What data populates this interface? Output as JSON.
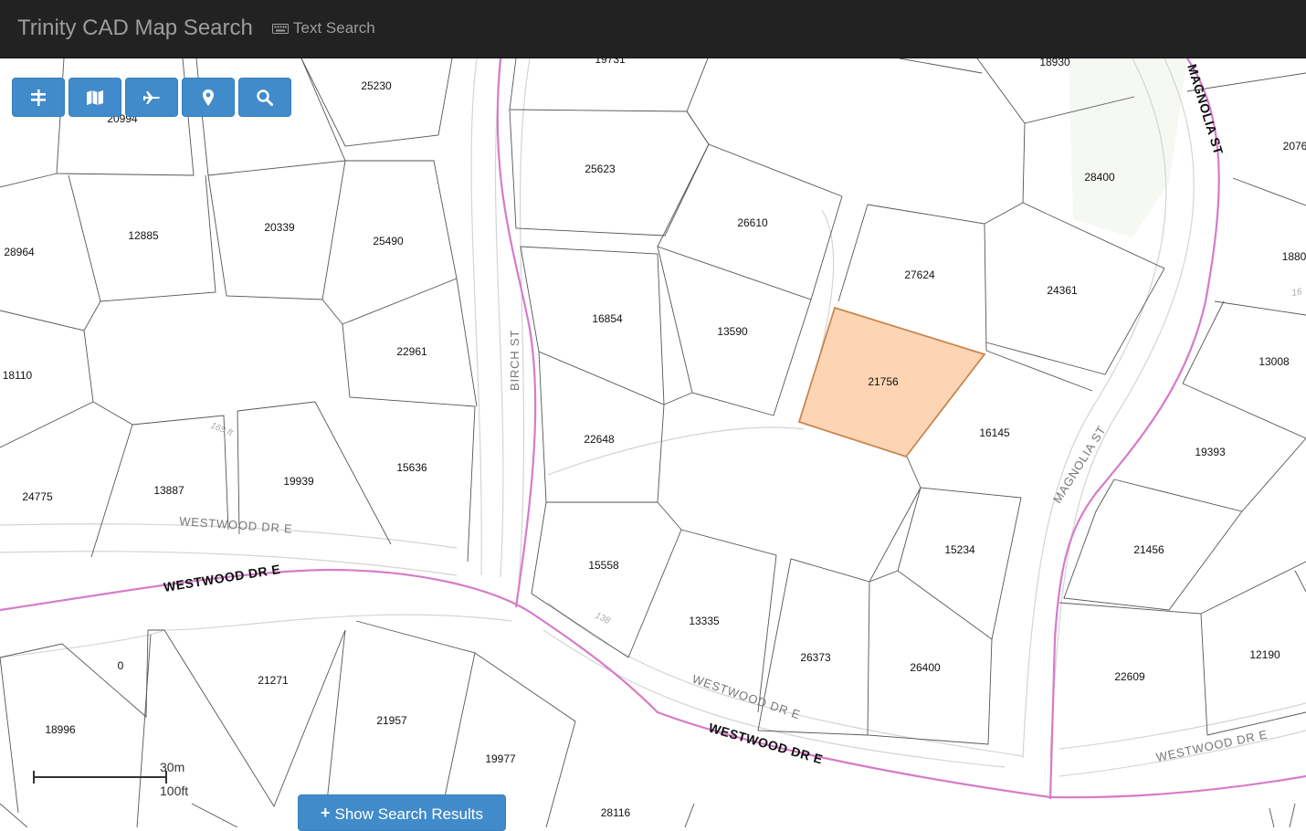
{
  "navbar": {
    "brand": "Trinity CAD Map Search",
    "text_search_label": "Text Search"
  },
  "toolbar": {
    "buttons": [
      {
        "name": "layers-button",
        "icon": "road-layers-icon"
      },
      {
        "name": "basemap-button",
        "icon": "map-icon"
      },
      {
        "name": "aerial-button",
        "icon": "plane-icon"
      },
      {
        "name": "locate-button",
        "icon": "map-marker-icon"
      },
      {
        "name": "search-button",
        "icon": "search-icon"
      }
    ]
  },
  "search_results_button": {
    "label": "Show Search Results",
    "icon": "plus-icon"
  },
  "scale": {
    "metric": "30m",
    "imperial": "100ft"
  },
  "map": {
    "highlight_color": "#fdd5b4",
    "highlight_stroke": "#c8864f",
    "parcels": [
      {
        "id": "p19731",
        "label": "19731"
      },
      {
        "id": "p18930",
        "label": "18930"
      },
      {
        "id": "p25230",
        "label": "25230"
      },
      {
        "id": "p20994",
        "label": "20994"
      },
      {
        "id": "p25623",
        "label": "25623"
      },
      {
        "id": "p28400",
        "label": "28400"
      },
      {
        "id": "p2076",
        "label": "2076"
      },
      {
        "id": "p12885",
        "label": "12885"
      },
      {
        "id": "p20339",
        "label": "20339"
      },
      {
        "id": "p25490",
        "label": "25490"
      },
      {
        "id": "p26610",
        "label": "26610"
      },
      {
        "id": "p28964",
        "label": "28964"
      },
      {
        "id": "p27624",
        "label": "27624"
      },
      {
        "id": "p1880",
        "label": "1880"
      },
      {
        "id": "p24361",
        "label": "24361"
      },
      {
        "id": "p16854",
        "label": "16854"
      },
      {
        "id": "p13590",
        "label": "13590"
      },
      {
        "id": "p22961",
        "label": "22961"
      },
      {
        "id": "p18110",
        "label": "18110"
      },
      {
        "id": "p13008",
        "label": "13008"
      },
      {
        "id": "p21756",
        "label": "21756"
      },
      {
        "id": "p22648",
        "label": "22648"
      },
      {
        "id": "p16145",
        "label": "16145"
      },
      {
        "id": "p19393",
        "label": "19393"
      },
      {
        "id": "p15636",
        "label": "15636"
      },
      {
        "id": "p19939",
        "label": "19939"
      },
      {
        "id": "p13887",
        "label": "13887"
      },
      {
        "id": "p24775",
        "label": "24775"
      },
      {
        "id": "p15234",
        "label": "15234"
      },
      {
        "id": "p21456",
        "label": "21456"
      },
      {
        "id": "p15558",
        "label": "15558"
      },
      {
        "id": "p13335",
        "label": "13335"
      },
      {
        "id": "p12190",
        "label": "12190"
      },
      {
        "id": "p26373",
        "label": "26373"
      },
      {
        "id": "p26400",
        "label": "26400"
      },
      {
        "id": "p22609",
        "label": "22609"
      },
      {
        "id": "p0",
        "label": "0"
      },
      {
        "id": "p21271",
        "label": "21271"
      },
      {
        "id": "p21957",
        "label": "21957"
      },
      {
        "id": "p18996",
        "label": "18996"
      },
      {
        "id": "p19977",
        "label": "19977"
      },
      {
        "id": "p28116",
        "label": "28116"
      }
    ],
    "roads": {
      "magnolia_top": "MAGNOLIA ST",
      "magnolia_mid": "MAGNOLIA ST",
      "birch": "BIRCH ST",
      "westwood_upper": "WESTWOOD DR E",
      "westwood_main_left": "WESTWOOD DR E",
      "westwood_mid": "WESTWOOD DR E",
      "westwood_main_right": "WESTWOOD DR E",
      "westwood_right": "WESTWOOD DR E"
    },
    "dimensions": {
      "d169": "169 ft",
      "d138": "138",
      "d16": "16"
    }
  }
}
